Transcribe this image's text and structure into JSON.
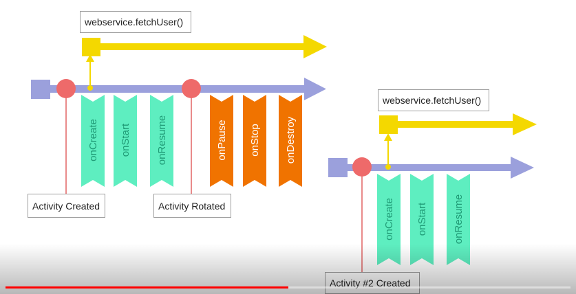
{
  "colors": {
    "timeline": "#9ba0dc",
    "event_dot": "#ee6a6a",
    "callback_green": "#5eeec0",
    "callback_orange": "#f07300",
    "request_yellow": "#f4d800",
    "callout_line": "#e98a8a",
    "label_text_green": "#1f9a75",
    "label_text_orange": "#ffffff"
  },
  "activity1": {
    "request_label": "webservice.fetchUser()",
    "created_label": "Activity Created",
    "rotated_label": "Activity Rotated",
    "callbacks": [
      {
        "label": "onCreate",
        "kind": "green",
        "icon": "chevron-ribbon"
      },
      {
        "label": "onStart",
        "kind": "green",
        "icon": "chevron-ribbon"
      },
      {
        "label": "onResume",
        "kind": "green",
        "icon": "chevron-ribbon"
      },
      {
        "label": "onPause",
        "kind": "orange",
        "icon": "chevron-ribbon"
      },
      {
        "label": "onStop",
        "kind": "orange",
        "icon": "chevron-ribbon"
      },
      {
        "label": "onDestroy",
        "kind": "orange",
        "icon": "chevron-ribbon"
      }
    ]
  },
  "activity2": {
    "request_label": "webservice.fetchUser()",
    "created_label": "Activity #2 Created",
    "callbacks": [
      {
        "label": "onCreate",
        "kind": "green",
        "icon": "chevron-ribbon"
      },
      {
        "label": "onStart",
        "kind": "green",
        "icon": "chevron-ribbon"
      },
      {
        "label": "onResume",
        "kind": "green",
        "icon": "chevron-ribbon"
      }
    ]
  },
  "video_progress": {
    "played_fraction": 0.5,
    "loaded_fraction": 0.56
  }
}
